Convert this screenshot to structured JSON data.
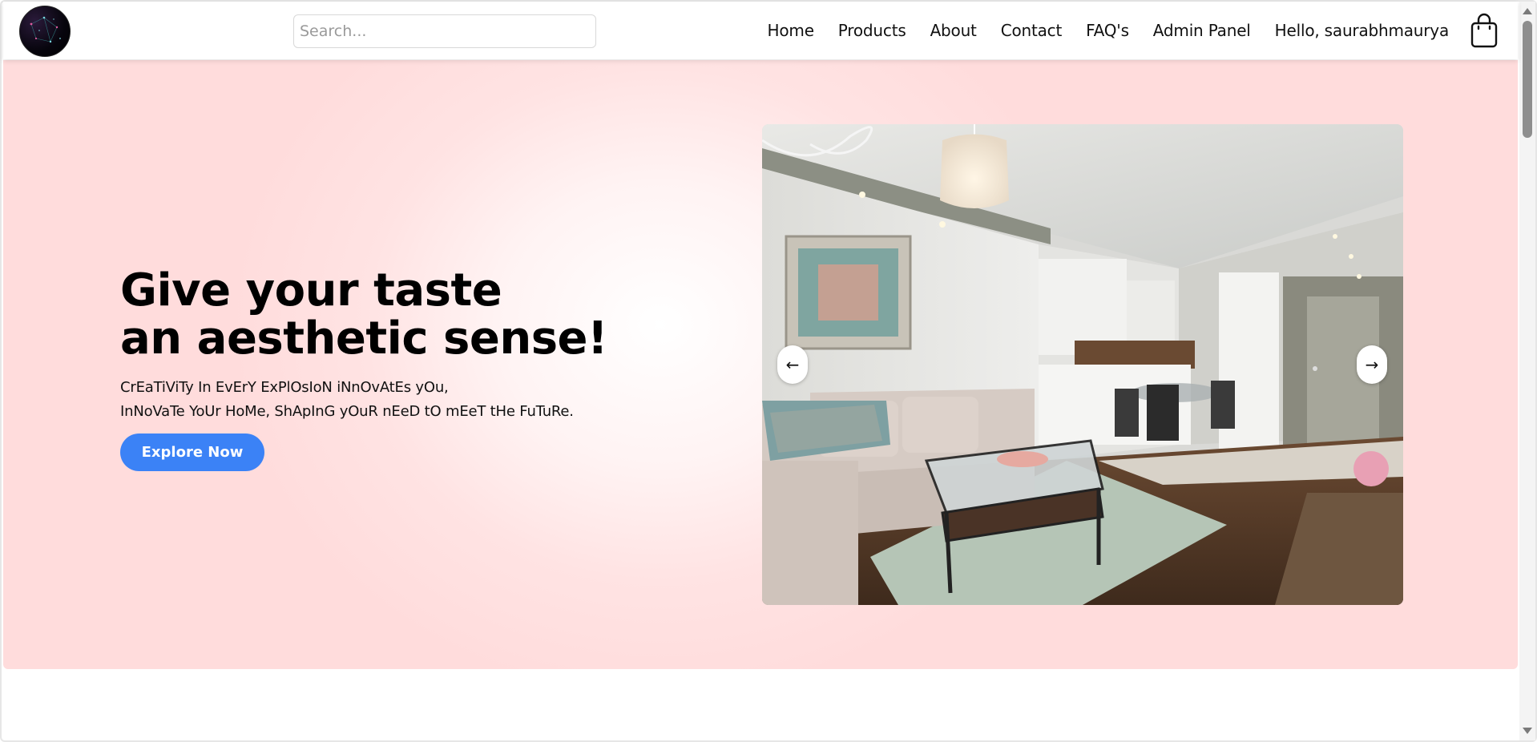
{
  "navbar": {
    "logo_icon": "galaxy-logo",
    "search": {
      "placeholder": "Search...",
      "value": ""
    },
    "links": [
      {
        "label": "Home"
      },
      {
        "label": "Products"
      },
      {
        "label": "About"
      },
      {
        "label": "Contact"
      },
      {
        "label": "FAQ's"
      },
      {
        "label": "Admin Panel"
      },
      {
        "label": "Hello, saurabhmaurya"
      }
    ],
    "cart_icon": "shopping-bag-icon"
  },
  "hero": {
    "title_line1": "Give your taste",
    "title_line2": "an aesthetic sense!",
    "subtitle_line1": "CrEaTiViTy In EvErY ExPlOsIoN iNnOvAtEs yOu,",
    "subtitle_line2": "InNoVaTe YoUr HoMe, ShApInG yOuR nEeD tO mEeT tHe FuTuRe.",
    "cta_label": "Explore Now",
    "carousel": {
      "prev_label": "←",
      "next_label": "→",
      "image_icon": "living-room-photo"
    },
    "colors": {
      "background": "#ffdcdc",
      "cta": "#3b82f6"
    }
  }
}
